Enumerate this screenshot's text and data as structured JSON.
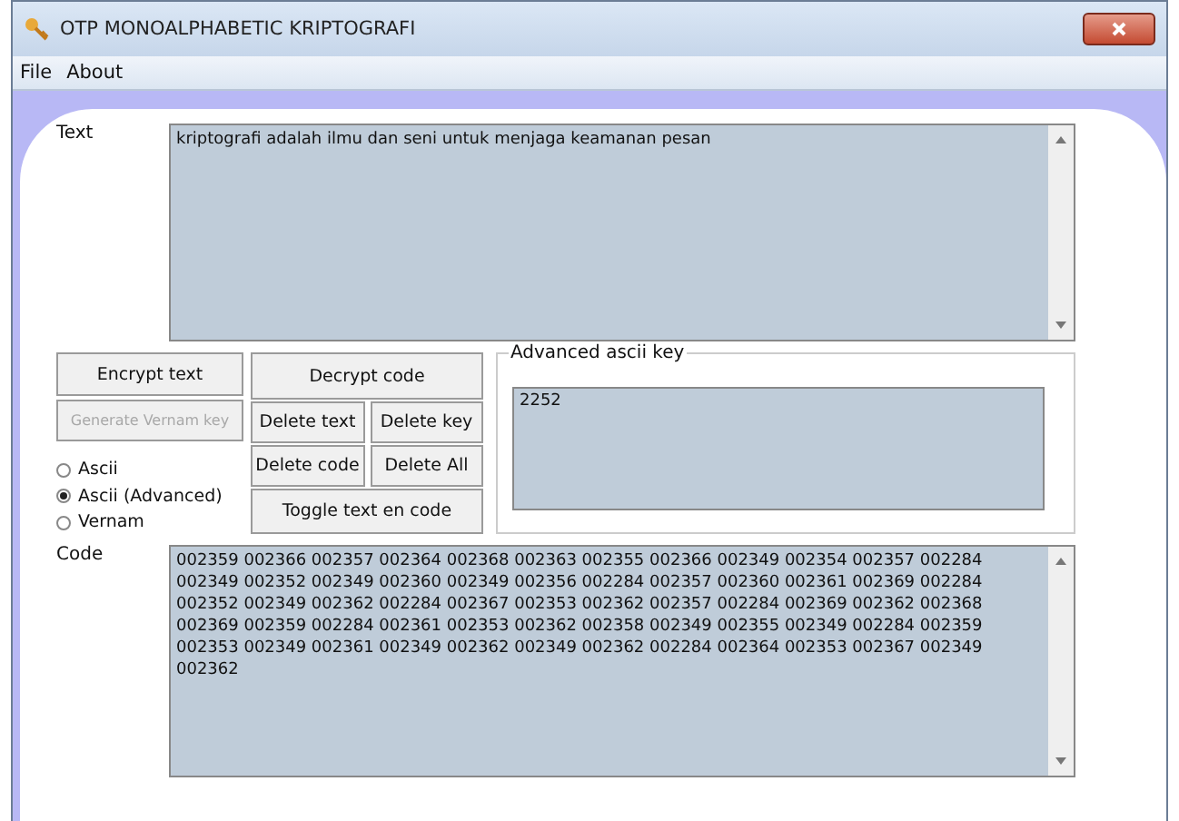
{
  "window": {
    "title": "OTP MONOALPHABETIC KRIPTOGRAFI"
  },
  "menu": [
    "File",
    "About"
  ],
  "text_field": {
    "label": "Text",
    "value": "kriptografi adalah ilmu dan seni untuk menjaga keamanan pesan"
  },
  "left_buttons": [
    {
      "label": "Encrypt text",
      "disabled": false
    },
    {
      "label": "Generate Vernam key",
      "disabled": true
    }
  ],
  "modes": [
    {
      "label": "Ascii",
      "selected": false
    },
    {
      "label": "Ascii (Advanced)",
      "selected": true
    },
    {
      "label": "Vernam",
      "selected": false
    }
  ],
  "middle_buttons": {
    "decrypt": "Decrypt code",
    "delete_text": "Delete text",
    "delete_key": "Delete key",
    "delete_code": "Delete code",
    "delete_all": "Delete All",
    "toggle": "Toggle text en code"
  },
  "key_group": {
    "title": "Advanced ascii key",
    "value": "2252"
  },
  "code_field": {
    "label": "Code",
    "value": "002359 002366 002357 002364 002368 002363 002355 002366 002349 002354 002357 002284 002349 002352 002349 002360 002349 002356 002284 002357 002360 002361 002369 002284 002352 002349 002362 002284 002367 002353 002362 002357 002284 002369 002362 002368 002369 002359 002284 002361 002353 002362 002358 002349 002355 002349 002284 002359 002353 002349 002361 002349 002362 002349 002362 002284 002364 002353 002367 002349 002362"
  }
}
